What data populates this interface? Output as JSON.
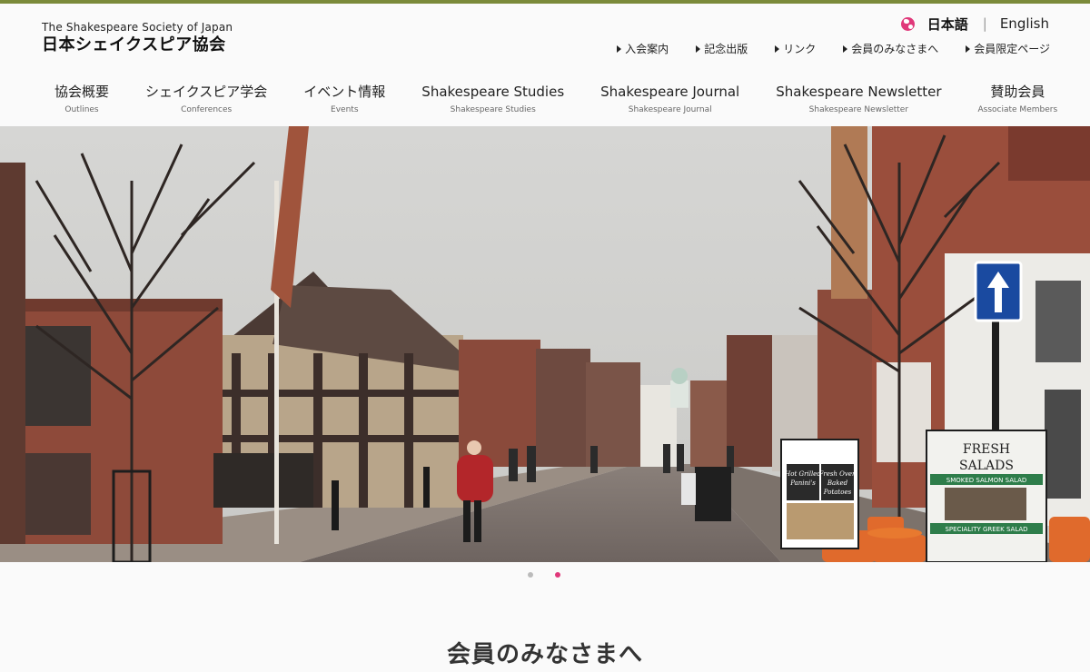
{
  "brand": {
    "name_en": "The Shakespeare Society of Japan",
    "name_ja": "日本シェイクスピア協会"
  },
  "language": {
    "current": "日本語",
    "separator": "|",
    "other": "English"
  },
  "utility_nav": [
    {
      "label": "入会案内"
    },
    {
      "label": "記念出版"
    },
    {
      "label": "リンク"
    },
    {
      "label": "会員のみなさまへ"
    },
    {
      "label": "会員限定ページ"
    }
  ],
  "global_nav": [
    {
      "label": "協会概要",
      "sub": "Outlines"
    },
    {
      "label": "シェイクスピア学会",
      "sub": "Conferences"
    },
    {
      "label": "イベント情報",
      "sub": "Events"
    },
    {
      "label": "Shakespeare Studies",
      "sub": "Shakespeare Studies"
    },
    {
      "label": "Shakespeare Journal",
      "sub": "Shakespeare Journal"
    },
    {
      "label": "Shakespeare Newsletter",
      "sub": "Shakespeare Newsletter"
    },
    {
      "label": "賛助会員",
      "sub": "Associate Members"
    }
  ],
  "hero": {
    "signs": {
      "fresh": "FRESH",
      "salads": "SALADS",
      "smoked": "SMOKED SALMON SALAD",
      "speciality": "SPECIALITY GREEK SALAD",
      "hot": "Hot Grilled",
      "panini": "Panini's",
      "fresh_oven": "Fresh Oven",
      "baked": "Baked",
      "potatoes": "Potatoes"
    },
    "slides": 2,
    "active_slide": 2
  },
  "section": {
    "title": "会員のみなさまへ"
  },
  "colors": {
    "accent_bar": "#7b8a3a",
    "accent_pink": "#e0387a"
  }
}
